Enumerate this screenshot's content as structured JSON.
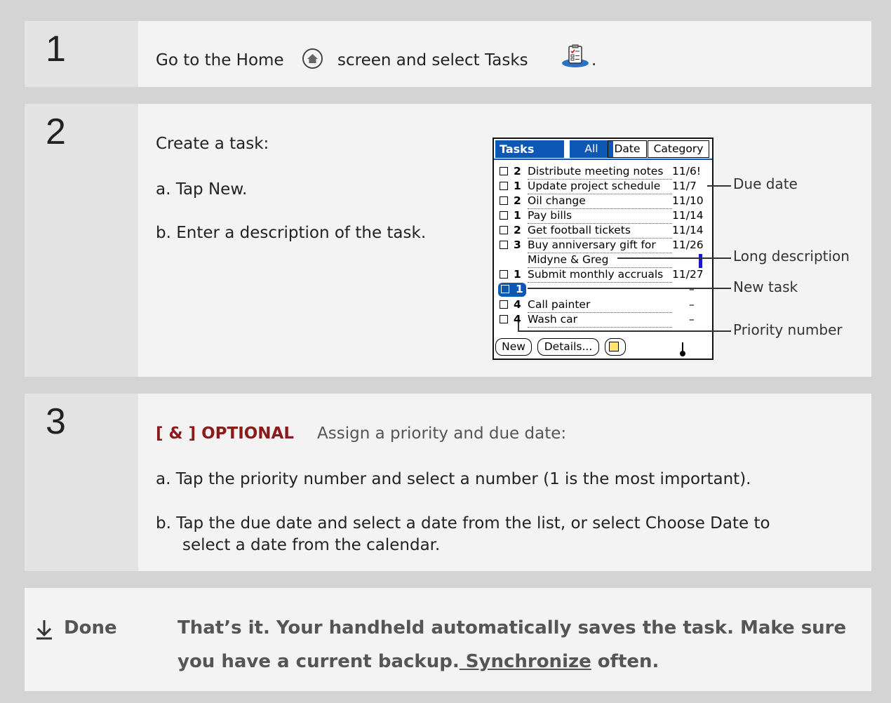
{
  "steps": [
    {
      "number": "1"
    },
    {
      "number": "2"
    },
    {
      "number": "3"
    }
  ],
  "step1": {
    "text_before_home": "Go to the Home",
    "text_after_home": "screen and select Tasks",
    "period": "."
  },
  "step2": {
    "intro": "Create a task:",
    "item_a": "a.  Tap New.",
    "item_b": "b.  Enter a description of the task."
  },
  "palm": {
    "title": "Tasks",
    "tabs": [
      "All",
      "Date",
      "Category"
    ],
    "tasks": [
      {
        "priority": "2",
        "description": "Distribute meeting notes",
        "due": "11/6!"
      },
      {
        "priority": "1",
        "description": "Update project schedule",
        "due": "11/7"
      },
      {
        "priority": "2",
        "description": "Oil change",
        "due": "11/10"
      },
      {
        "priority": "1",
        "description": "Pay bills",
        "due": "11/14"
      },
      {
        "priority": "2",
        "description": "Get football tickets",
        "due": "11/14"
      },
      {
        "priority": "3",
        "description": "Buy anniversary gift for",
        "due": "11/26"
      },
      {
        "priority": "",
        "description": "Midyne & Greg",
        "due": ""
      },
      {
        "priority": "1",
        "description": "Submit monthly accruals",
        "due": "11/27"
      },
      {
        "priority": "1",
        "description": "",
        "due": "–"
      },
      {
        "priority": "4",
        "description": "Call painter",
        "due": "–"
      },
      {
        "priority": "4",
        "description": "Wash car",
        "due": "–"
      }
    ],
    "buttons": {
      "new": "New",
      "details": "Details..."
    }
  },
  "callouts": {
    "due_date": "Due date",
    "long_description": "Long description",
    "new_task": "New task",
    "priority_number": "Priority number"
  },
  "step3": {
    "optional_tag": "[ & ]  OPTIONAL",
    "heading": "Assign a priority and due date:",
    "item_a": "a.  Tap the priority number and select a number (1 is the most important).",
    "item_b_line1": "b.  Tap the due date and select a date from the list, or select Choose Date to",
    "item_b_line2": "select a date from the calendar."
  },
  "done": {
    "label": "Done",
    "line1": "That’s it. Your handheld automatically saves the task. Make sure",
    "line2_before": "you have a current backup.",
    "link": " Synchronize",
    "line2_after": " often."
  }
}
